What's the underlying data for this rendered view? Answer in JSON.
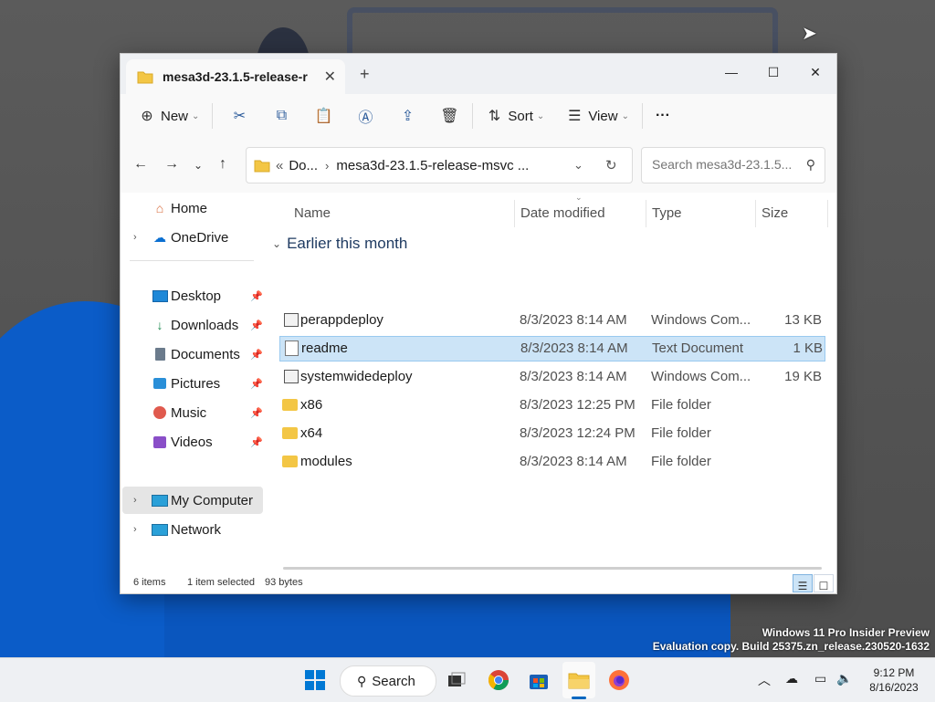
{
  "desktop": {
    "watermark_line1": "Windows 11 Pro Insider Preview",
    "watermark_line2": "Evaluation copy. Build 25375.zn_release.230520-1632"
  },
  "window": {
    "tab_title": "mesa3d-23.1.5-release-r",
    "tab_close": "✕",
    "new_tab": "+",
    "minimize": "—",
    "maximize": "☐",
    "close": "✕"
  },
  "toolbar": {
    "new_label": "New",
    "sort_label": "Sort",
    "view_label": "View",
    "more_label": "···"
  },
  "nav": {
    "breadcrumb_overflow": "«",
    "breadcrumb_parent": "Do...",
    "breadcrumb_current": "mesa3d-23.1.5-release-msvc ...",
    "search_placeholder": "Search mesa3d-23.1.5..."
  },
  "sidebar": {
    "items": [
      {
        "label": "Home",
        "icon": "home-icon"
      },
      {
        "label": "OneDrive",
        "icon": "cloud-icon"
      },
      {
        "label": "Desktop",
        "icon": "desktop-icon"
      },
      {
        "label": "Downloads",
        "icon": "download-icon"
      },
      {
        "label": "Documents",
        "icon": "documents-icon"
      },
      {
        "label": "Pictures",
        "icon": "pictures-icon"
      },
      {
        "label": "Music",
        "icon": "music-icon"
      },
      {
        "label": "Videos",
        "icon": "videos-icon"
      },
      {
        "label": "My Computer",
        "icon": "computer-icon"
      },
      {
        "label": "Network",
        "icon": "network-icon"
      }
    ]
  },
  "list": {
    "columns": [
      "Name",
      "Date modified",
      "Type",
      "Size"
    ],
    "group_label": "Earlier this month",
    "rows": [
      {
        "name": "perappdeploy",
        "date": "8/3/2023 8:14 AM",
        "type": "Windows Com...",
        "size": "13 KB"
      },
      {
        "name": "readme",
        "date": "8/3/2023 8:14 AM",
        "type": "Text Document",
        "size": "1 KB"
      },
      {
        "name": "systemwidedeploy",
        "date": "8/3/2023 8:14 AM",
        "type": "Windows Com...",
        "size": "19 KB"
      },
      {
        "name": "x86",
        "date": "8/3/2023 12:25 PM",
        "type": "File folder",
        "size": ""
      },
      {
        "name": "x64",
        "date": "8/3/2023 12:24 PM",
        "type": "File folder",
        "size": ""
      },
      {
        "name": "modules",
        "date": "8/3/2023 8:14 AM",
        "type": "File folder",
        "size": ""
      }
    ]
  },
  "status": {
    "items": "6 items",
    "selected": "1 item selected",
    "size": "93 bytes"
  },
  "taskbar": {
    "search_label": "Search",
    "time": "9:12 PM",
    "date": "8/16/2023"
  },
  "colors": {
    "accent": "#0067c0",
    "selection": "#cce4f7",
    "wallpaper_blue": "#0b5cc8"
  }
}
